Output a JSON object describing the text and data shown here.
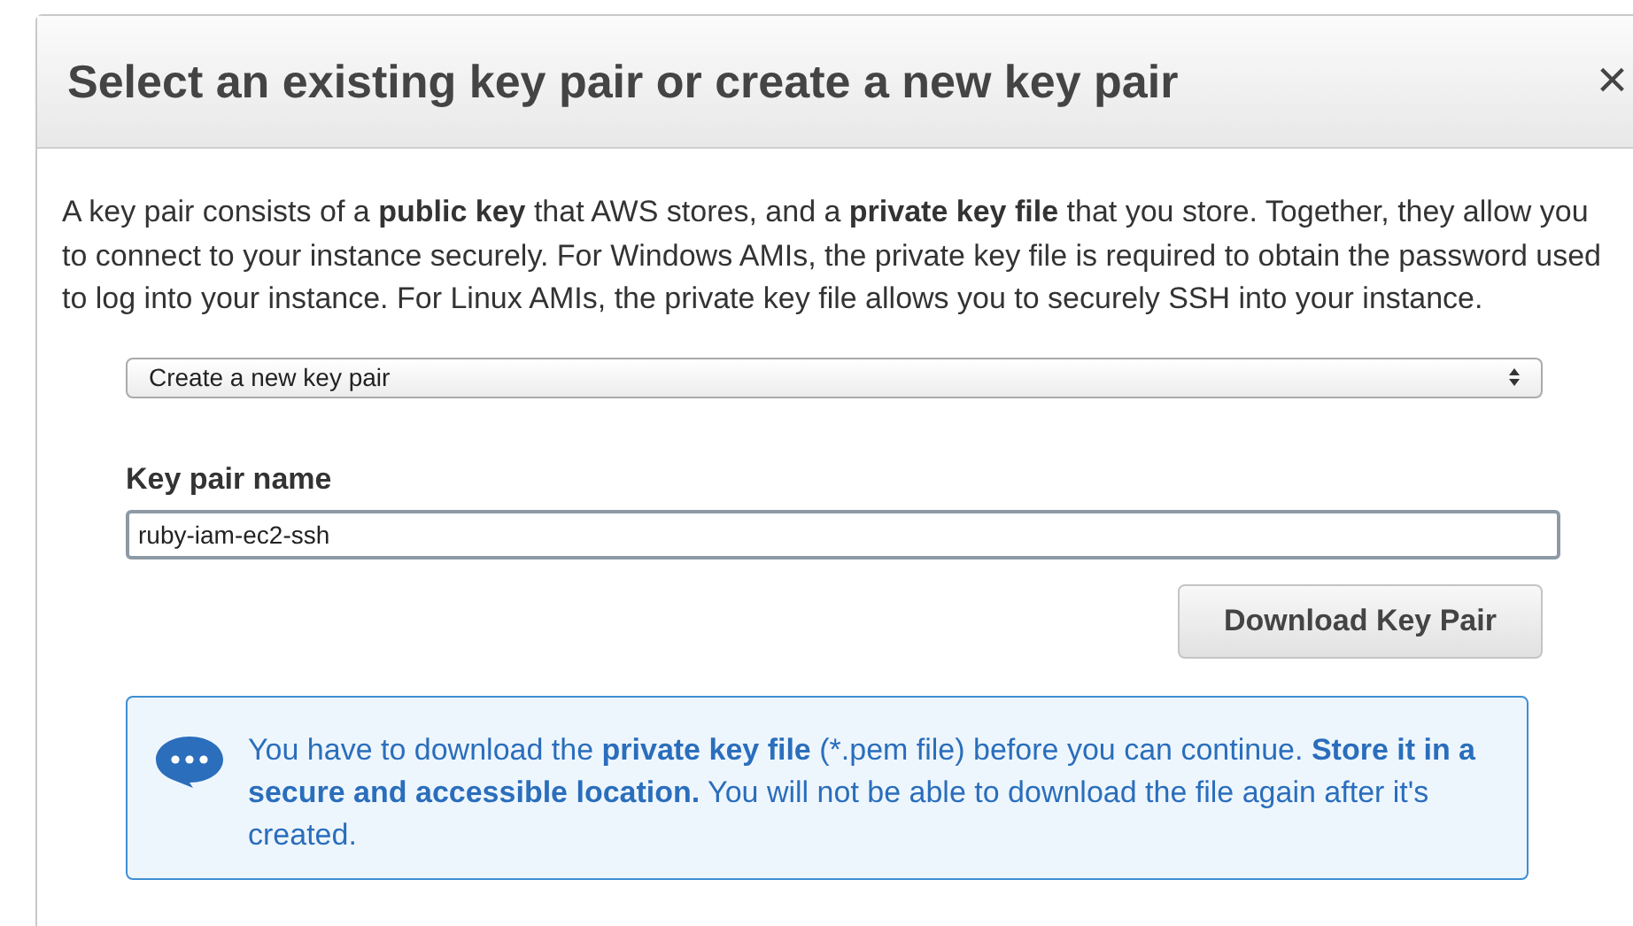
{
  "dialog": {
    "title": "Select an existing key pair or create a new key pair",
    "close": "×",
    "description": "A key pair consists of a **public key** that AWS stores, and a **private key file** that you store. Together, they allow you to connect to your instance securely. For Windows AMIs, the private key file is required to obtain the password used to log into your instance. For Linux AMIs, the private key file allows you to securely SSH into your instance.",
    "key_pair_option": {
      "value": "Create a new key pair"
    },
    "key_pair_name": {
      "label": "Key pair name",
      "value": "ruby-iam-ec2-ssh"
    },
    "download_button": "Download Key Pair",
    "info": "You have to download the **private key file** (*.pem file) before you can continue. **Store it in a secure and accessible location.** You will not be able to download the file again after it's created."
  }
}
